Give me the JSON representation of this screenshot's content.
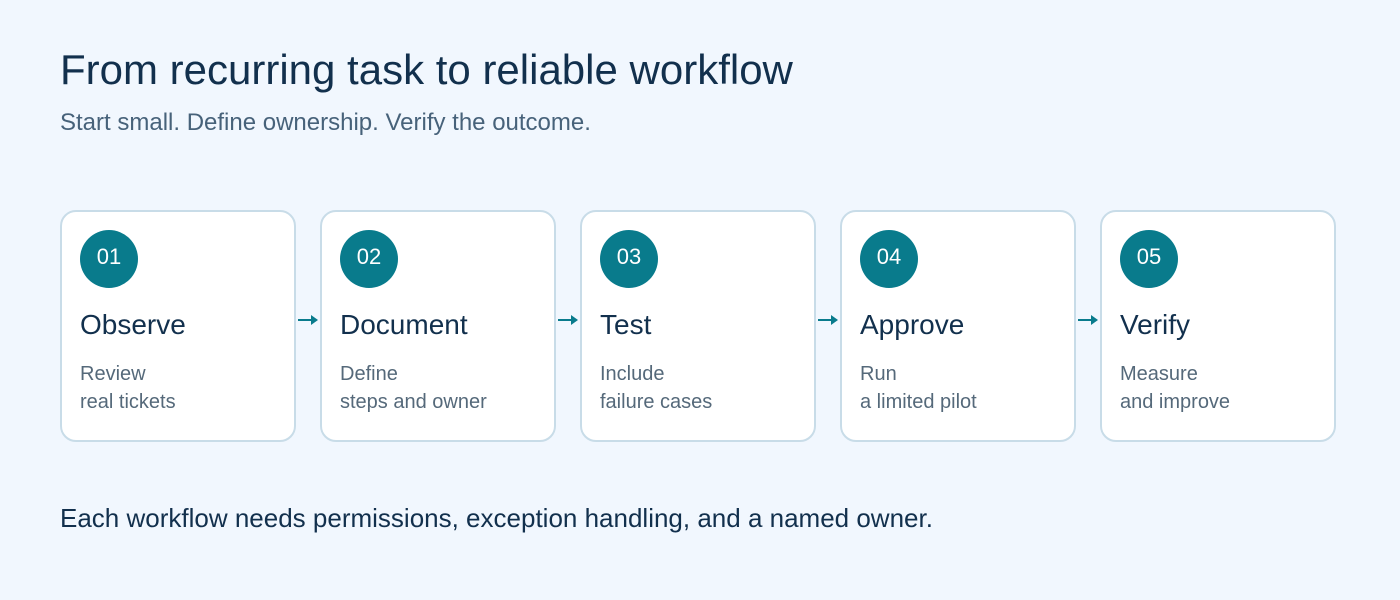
{
  "header": {
    "title": "From recurring task to reliable workflow",
    "subtitle": "Start small. Define ownership. Verify the outcome."
  },
  "steps": [
    {
      "number": "01",
      "title": "Observe",
      "desc_line1": "Review",
      "desc_line2": "real tickets"
    },
    {
      "number": "02",
      "title": "Document",
      "desc_line1": "Define",
      "desc_line2": "steps and owner"
    },
    {
      "number": "03",
      "title": "Test",
      "desc_line1": "Include",
      "desc_line2": "failure cases"
    },
    {
      "number": "04",
      "title": "Approve",
      "desc_line1": "Run",
      "desc_line2": "a limited pilot"
    },
    {
      "number": "05",
      "title": "Verify",
      "desc_line1": "Measure",
      "desc_line2": "and improve"
    }
  ],
  "footer": {
    "note": "Each workflow needs permissions, exception handling, and a named owner."
  },
  "colors": {
    "background": "#f1f7fe",
    "accent": "#097b8c",
    "title_text": "#12304d",
    "card_border": "#c8dce8"
  },
  "icons": {
    "connector": "arrow-right-icon"
  }
}
